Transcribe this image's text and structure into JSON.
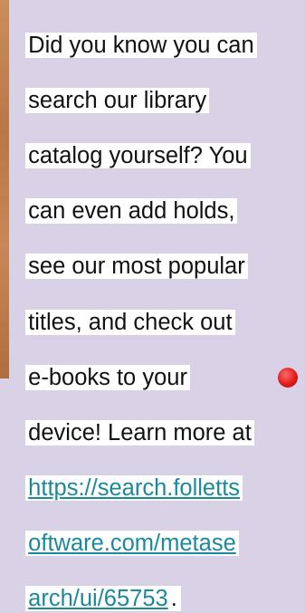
{
  "note": {
    "lines": [
      "Did you know you can",
      "search our library",
      "catalog yourself? You",
      "can even add holds,",
      "see our most popular",
      "titles, and check out",
      "e-books to your",
      "device! Learn more at"
    ],
    "link_lines": [
      "https://search.folletts",
      "oftware.com/metase",
      "arch/ui/65753"
    ],
    "trailing": "."
  },
  "colors": {
    "background": "#d9d1e6",
    "highlight": "#ffffff",
    "link": "#1a8a9a",
    "pin": "#e01c1c"
  },
  "icons": {
    "pin": "red-pushpin"
  }
}
